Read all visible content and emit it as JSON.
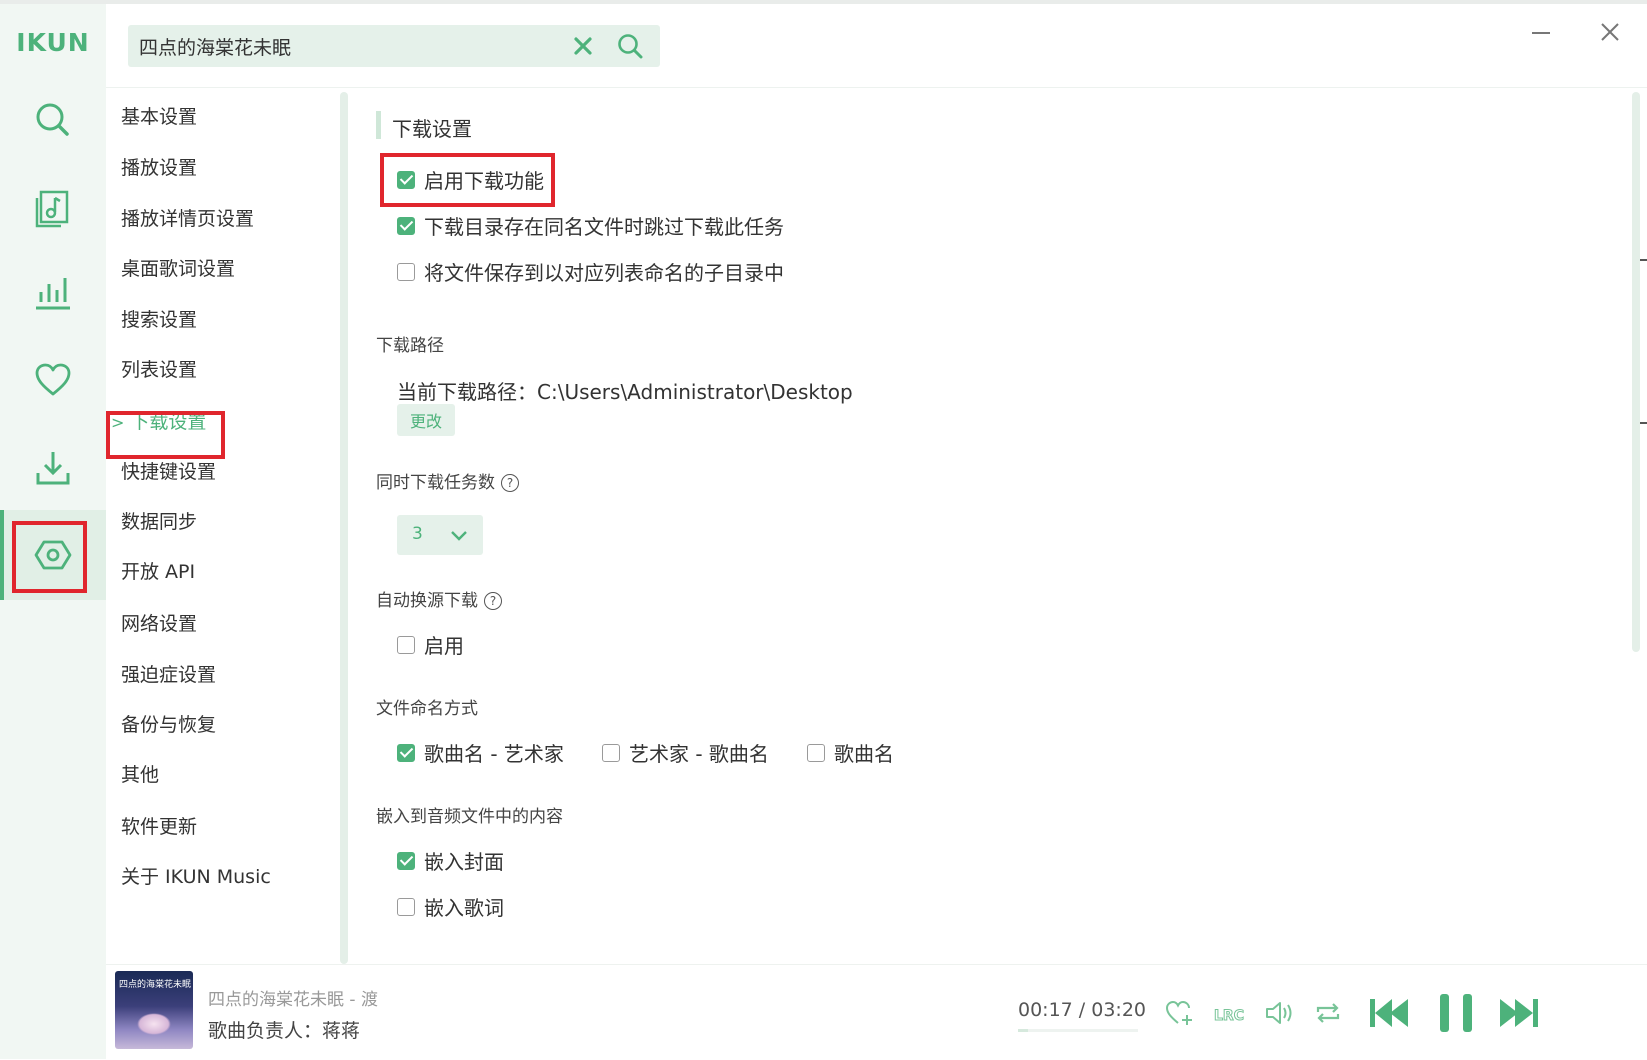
{
  "app": {
    "logo": "IKUN"
  },
  "search": {
    "value": "四点的海棠花未眠"
  },
  "rail": [
    "search-icon",
    "music-library-icon",
    "chart-icon",
    "heart-icon",
    "download-icon",
    "settings-icon"
  ],
  "nav": {
    "items": [
      "基本设置",
      "播放设置",
      "播放详情页设置",
      "桌面歌词设置",
      "搜索设置",
      "列表设置",
      "下载设置",
      "快捷键设置",
      "数据同步",
      "开放 API",
      "网络设置",
      "强迫症设置",
      "备份与恢复",
      "其他",
      "软件更新",
      "关于 IKUN Music"
    ],
    "active_prefix": ">"
  },
  "download": {
    "section_title": "下载设置",
    "enable": {
      "label": "启用下载功能",
      "checked": true
    },
    "skip_existing": {
      "label": "下载目录存在同名文件时跳过下载此任务",
      "checked": true
    },
    "save_subdir": {
      "label": "将文件保存到以对应列表命名的子目录中",
      "checked": false
    },
    "path_label": "下载路径",
    "current_path": "当前下载路径：C:\\Users\\Administrator\\Desktop",
    "change_button": "更改",
    "concurrent_label": "同时下载任务数",
    "concurrent_value": "3",
    "auto_switch_label": "自动换源下载",
    "auto_switch_enable": {
      "label": "启用",
      "checked": false
    },
    "naming_label": "文件命名方式",
    "naming_options": [
      {
        "label": "歌曲名 - 艺术家",
        "checked": true
      },
      {
        "label": "艺术家 - 歌曲名",
        "checked": false
      },
      {
        "label": "歌曲名",
        "checked": false
      }
    ],
    "embed_label": "嵌入到音频文件中的内容",
    "embed_cover": {
      "label": "嵌入封面",
      "checked": true
    },
    "embed_lyrics": {
      "label": "嵌入歌词",
      "checked": false
    },
    "help_glyph": "?"
  },
  "player": {
    "title": "四点的海棠花未眠 - 渡",
    "subtitle": "歌曲负责人：蒋蒋",
    "time": "00:17 / 03:20",
    "progress": 0.085,
    "cover_text": "四点的海棠花未眠"
  },
  "colors": {
    "accent": "#4db27b",
    "highlight": "#e0262d",
    "rail_bg": "#f1f7f3"
  }
}
